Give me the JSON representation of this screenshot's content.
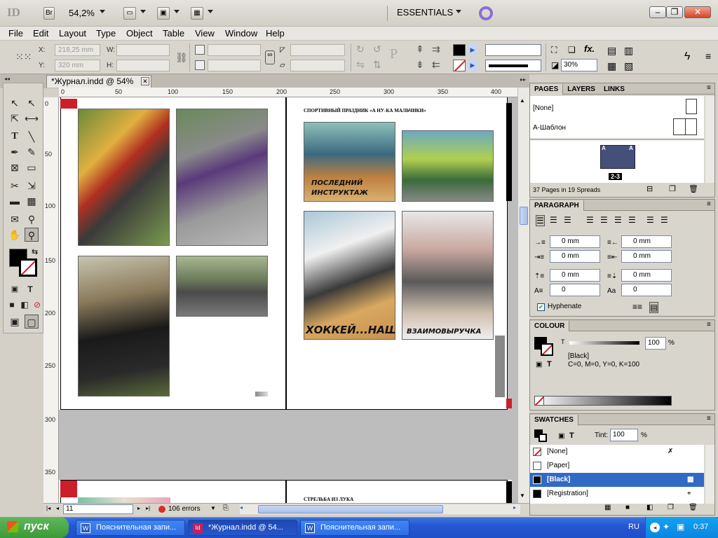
{
  "app": {
    "logo": "ID",
    "bridge": "Br",
    "zoom": "54,2%",
    "workspace": "ESSENTIALS"
  },
  "menu": [
    "File",
    "Edit",
    "Layout",
    "Type",
    "Object",
    "Table",
    "View",
    "Window",
    "Help"
  ],
  "control": {
    "x_label": "X:",
    "x_value": "218,25 mm",
    "y_label": "Y:",
    "y_value": "320 mm",
    "w_label": "W:",
    "h_label": "H:",
    "opacity": "30%"
  },
  "document": {
    "tab_title": "*Журнал.indd @ 54%",
    "ruler_top": [
      "0",
      "50",
      "100",
      "150",
      "200",
      "250",
      "300",
      "350",
      "400"
    ],
    "ruler_left": [
      "0",
      "50",
      "100",
      "150",
      "200",
      "250",
      "300",
      "350"
    ],
    "page_left": {
      "captions": []
    },
    "page_right": {
      "heading": "СПОРТИВНЫЙ ПРАЗДНИК «А НУ-КА МАЛЬЧИКИ»",
      "captions": [
        "ПОСЛЕДНИЙ ИНСТРУКТАЖ",
        "ХОККЕЙ...НАШ",
        "ВЗАИМОВЫРУЧКА"
      ]
    },
    "next_spread_heading": "СТРЕЛЬБА ИЗ ЛУКА"
  },
  "status": {
    "page": "11",
    "errors": "106 errors"
  },
  "pages_panel": {
    "tabs": [
      "PAGES",
      "LAYERS",
      "LINKS"
    ],
    "none_label": "[None]",
    "master_label": "А-Шаблон",
    "spread_label": "2-3",
    "master_marks": [
      "A",
      "A"
    ],
    "summary": "37 Pages in 19 Spreads"
  },
  "paragraph_panel": {
    "title": "PARAGRAPH",
    "left_indent": "0 mm",
    "right_indent": "0 mm",
    "first_indent": "0 mm",
    "last_indent": "0 mm",
    "space_before": "0 mm",
    "space_after": "0 mm",
    "drop_lines": "0",
    "drop_chars": "0",
    "hyphenate": "Hyphenate"
  },
  "colour_panel": {
    "title": "COLOUR",
    "t_label": "T",
    "tint": "100",
    "pct": "%",
    "swatch_name": "[Black]",
    "cmyk": "C=0, M=0, Y=0, K=100"
  },
  "swatches_panel": {
    "title": "SWATCHES",
    "tint_label": "Tint:",
    "tint": "100",
    "pct": "%",
    "items": [
      "[None]",
      "[Paper]",
      "[Black]",
      "[Registration]"
    ]
  },
  "taskbar": {
    "start": "пуск",
    "tasks": [
      "Пояснительная запи...",
      "*Журнал.indd @ 54...",
      "Пояснительная запи..."
    ],
    "lang": "RU",
    "time": "0:37"
  },
  "colors": {
    "accent_red": "#cc1f2a",
    "selection_blue": "#316ac5",
    "xp_taskbar": "#2457d4"
  }
}
